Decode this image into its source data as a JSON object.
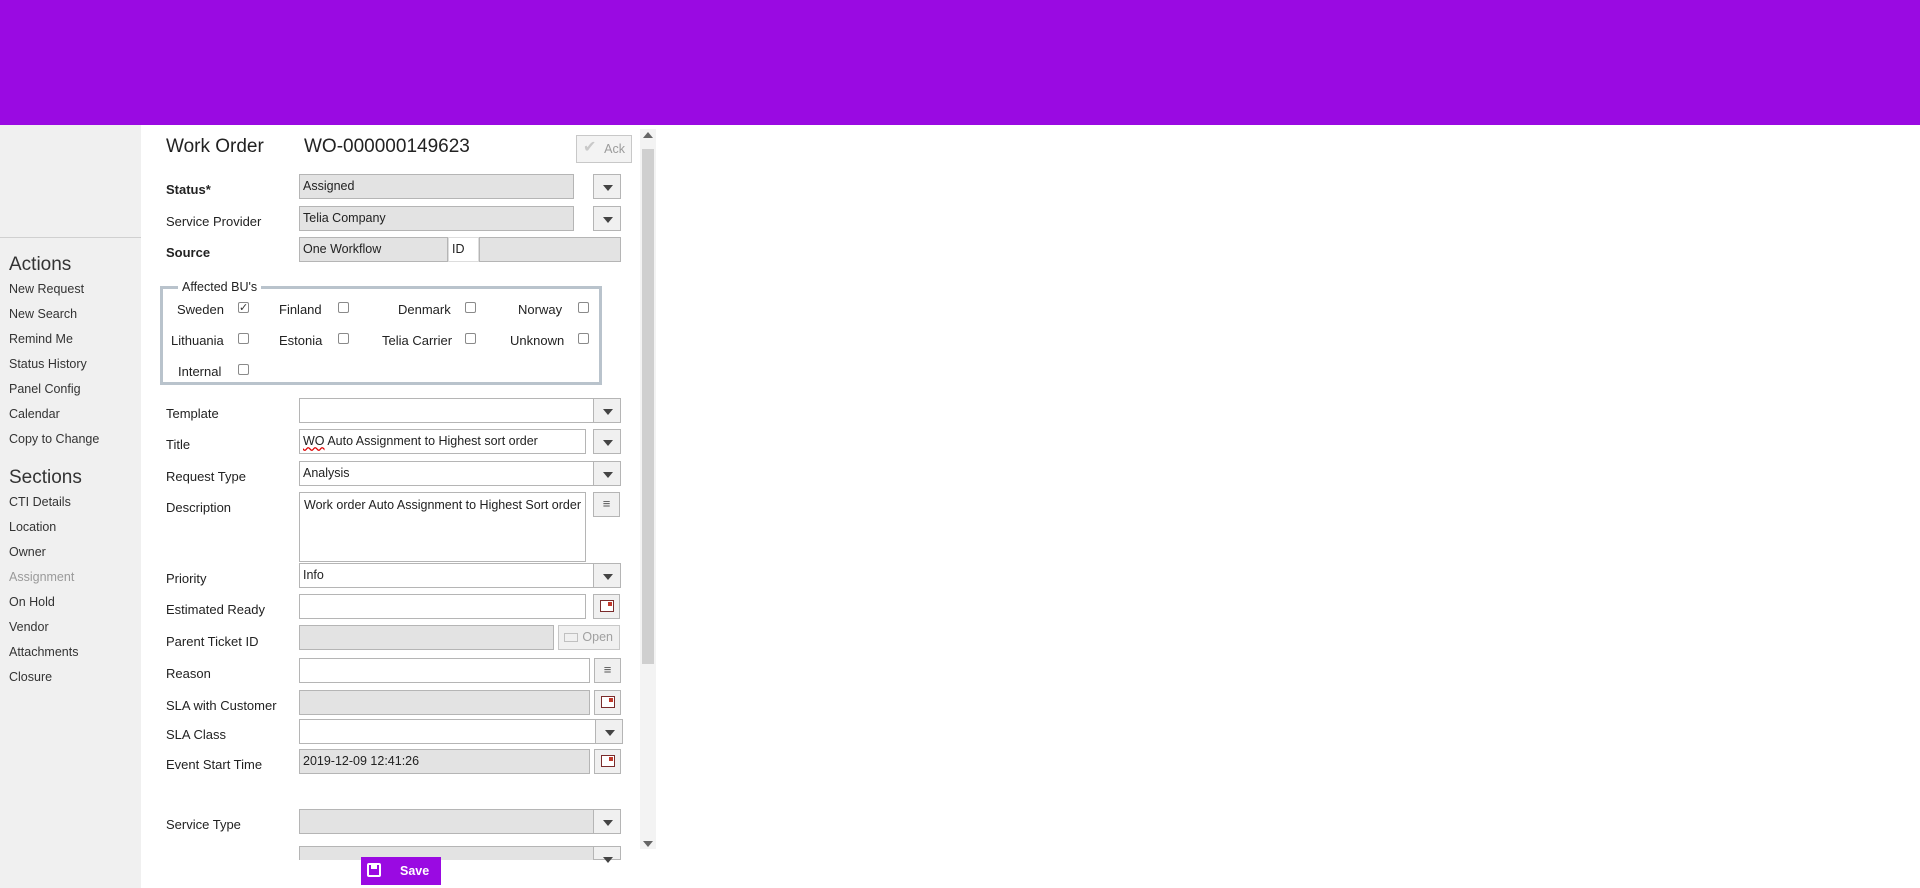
{
  "header": {
    "color": "#9a0ae2"
  },
  "sidebar": {
    "actions_title": "Actions",
    "actions": [
      "New Request",
      "New Search",
      "Remind Me",
      "Status History",
      "Panel Config",
      "Calendar",
      "Copy to Change"
    ],
    "sections_title": "Sections",
    "sections": [
      "CTI Details",
      "Location",
      "Owner",
      "Assignment",
      "On Hold",
      "Vendor",
      "Attachments",
      "Closure"
    ]
  },
  "form": {
    "heading": "Work Order",
    "number": "WO-000000149623",
    "ack_label": "Ack",
    "status_label": "Status*",
    "status_value": "Assigned",
    "service_provider_label": "Service Provider",
    "service_provider_value": "Telia Company",
    "source_label": "Source",
    "source_value": "One Workflow",
    "id_label": "ID",
    "id_value": "",
    "affected_bus": {
      "legend": "Affected BU's",
      "items": [
        {
          "label": "Sweden",
          "checked": true
        },
        {
          "label": "Finland",
          "checked": false
        },
        {
          "label": "Denmark",
          "checked": false
        },
        {
          "label": "Norway",
          "checked": false
        },
        {
          "label": "Lithuania",
          "checked": false
        },
        {
          "label": "Estonia",
          "checked": false
        },
        {
          "label": "Telia Carrier",
          "checked": false
        },
        {
          "label": "Unknown",
          "checked": false
        },
        {
          "label": "Internal",
          "checked": false
        }
      ]
    },
    "template_label": "Template",
    "template_value": "",
    "title_label": "Title",
    "title_value_prefix": "WO",
    "title_value_rest": " Auto Assignment to Highest sort order",
    "request_type_label": "Request Type",
    "request_type_value": "Analysis",
    "description_label": "Description",
    "description_value": "Work order Auto Assignment to Highest Sort order",
    "priority_label": "Priority",
    "priority_value": "Info",
    "estimated_ready_label": "Estimated Ready",
    "estimated_ready_value": "",
    "parent_ticket_label": "Parent Ticket ID",
    "parent_ticket_value": "",
    "open_label": "Open",
    "reason_label": "Reason",
    "reason_value": "",
    "sla_customer_label": "SLA with Customer",
    "sla_customer_value": "",
    "sla_class_label": "SLA Class",
    "sla_class_value": "",
    "event_start_label": "Event Start Time",
    "event_start_value": "2019-12-09 12:41:26",
    "service_type_label": "Service Type",
    "service_type_value": ""
  },
  "footer": {
    "save_label": "Save"
  },
  "icons": {
    "ack": "check-icon",
    "save": "save-disk-icon",
    "calendar": "calendar-icon",
    "notes": "list-icon",
    "folder": "folder-icon"
  }
}
